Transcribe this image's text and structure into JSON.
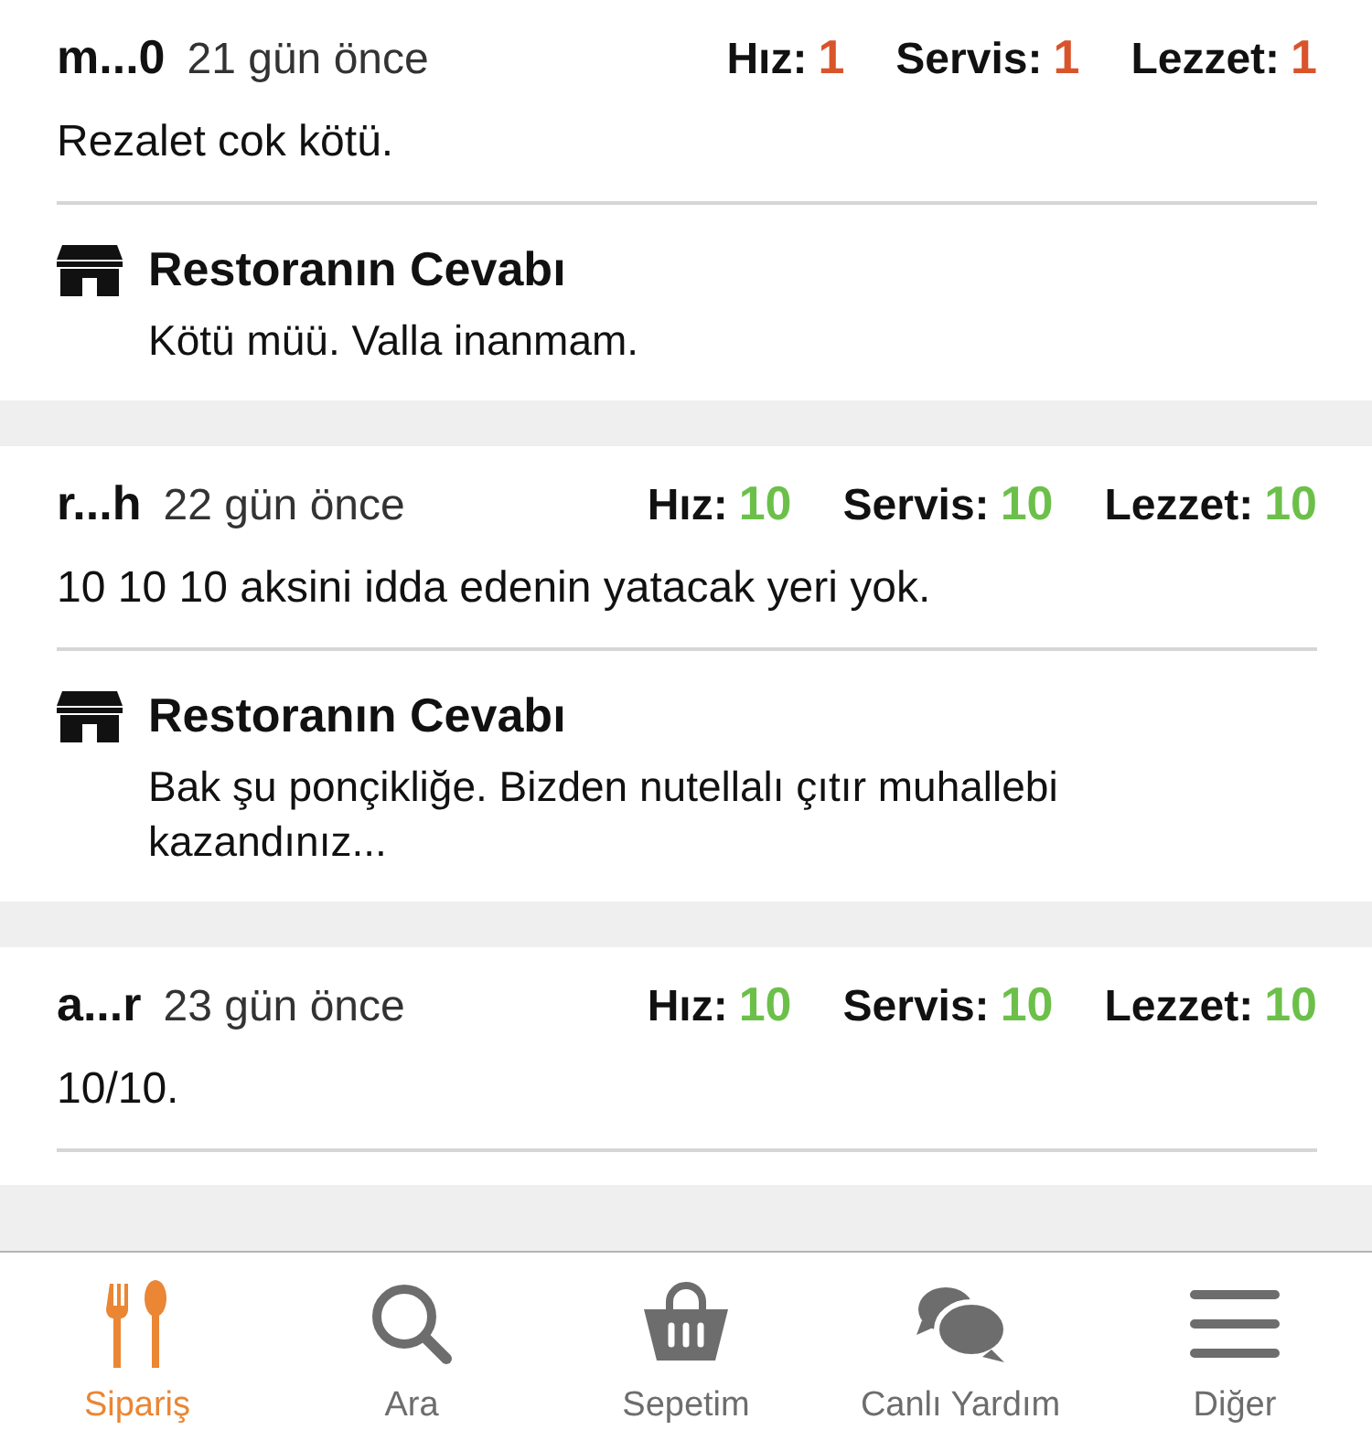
{
  "reviews": [
    {
      "user": "m...0",
      "time": "21 gün önce",
      "scores": [
        {
          "label": "Hız:",
          "value": "1",
          "color": "#d9542b"
        },
        {
          "label": "Servis:",
          "value": "1",
          "color": "#d9542b"
        },
        {
          "label": "Lezzet:",
          "value": "1",
          "color": "#d9542b"
        }
      ],
      "comment": "Rezalet cok kötü.",
      "reply": {
        "title": "Restoranın Cevabı",
        "text": "Kötü müü. Valla inanmam."
      }
    },
    {
      "user": "r...h",
      "time": "22 gün önce",
      "scores": [
        {
          "label": "Hız:",
          "value": "10",
          "color": "#6cc04a"
        },
        {
          "label": "Servis:",
          "value": "10",
          "color": "#6cc04a"
        },
        {
          "label": "Lezzet:",
          "value": "10",
          "color": "#6cc04a"
        }
      ],
      "comment": "10 10 10 aksini idda edenin yatacak yeri yok.",
      "reply": {
        "title": "Restoranın Cevabı",
        "text": "Bak şu ponçikliğe. Bizden nutellalı çıtır muhallebi kazandınız..."
      }
    },
    {
      "user": "a...r",
      "time": "23 gün önce",
      "scores": [
        {
          "label": "Hız:",
          "value": "10",
          "color": "#6cc04a"
        },
        {
          "label": "Servis:",
          "value": "10",
          "color": "#6cc04a"
        },
        {
          "label": "Lezzet:",
          "value": "10",
          "color": "#6cc04a"
        }
      ],
      "comment": "10/10."
    }
  ],
  "tab_bar": [
    {
      "label": "Sipariş",
      "kind": "food",
      "selected": true
    },
    {
      "label": "Ara",
      "kind": "search",
      "selected": false
    },
    {
      "label": "Sepetim",
      "kind": "basket",
      "selected": false
    },
    {
      "label": "Canlı Yardım",
      "kind": "chat",
      "selected": false
    },
    {
      "label": "Diğer",
      "kind": "menu",
      "selected": false
    }
  ]
}
